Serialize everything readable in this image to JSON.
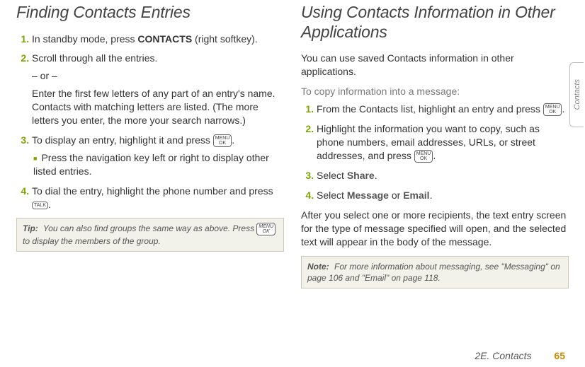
{
  "left": {
    "title": "Finding Contacts Entries",
    "steps": [
      {
        "pre": "In standby mode, press ",
        "softkey": "CONTACTS",
        "post": " (right softkey)."
      },
      {
        "pre": "Scroll through all the entries.",
        "or": "– or –",
        "sub": "Enter the first few letters of any part of an entry's name. Contacts with matching letters are listed. (The more letters you enter, the more your search narrows.)"
      },
      {
        "pre": "To display an entry, highlight it and press ",
        "key": "MENU/OK",
        "post": ".",
        "bullet": "Press the navigation key left or right to display other listed entries."
      },
      {
        "pre": "To dial the entry, highlight the phone number and press ",
        "key": "TALK",
        "post": "."
      }
    ],
    "tip_label": "Tip:",
    "tip_text_a": "You can also find groups the same way as above. Press ",
    "tip_key": "MENU/OK",
    "tip_text_b": " to display the members of the group."
  },
  "right": {
    "title": "Using Contacts Information in Other Applications",
    "intro": "You can use saved Contacts information in other applications.",
    "subhead": "To copy information into a message:",
    "steps": [
      {
        "pre": "From the Contacts list, highlight an entry and press ",
        "key": "MENU/OK",
        "post": "."
      },
      {
        "pre": "Highlight the information you want to copy, such as phone numbers, email addresses, URLs, or street addresses, and press ",
        "key": "MENU/OK",
        "post": "."
      },
      {
        "pre": "Select ",
        "bold": "Share",
        "post": "."
      },
      {
        "pre": "Select ",
        "bold": "Message",
        "mid": " or ",
        "bold2": "Email",
        "post": "."
      }
    ],
    "after": "After you select one or more recipients, the text entry screen for the type of message specified will open, and the selected text will appear in the body of the message.",
    "note_label": "Note:",
    "note_text": "For more information about messaging, see \"Messaging\" on page 106 and \"Email\" on page 118."
  },
  "side_tab": "Contacts",
  "footer_chapter": "2E. Contacts",
  "footer_page": "65"
}
